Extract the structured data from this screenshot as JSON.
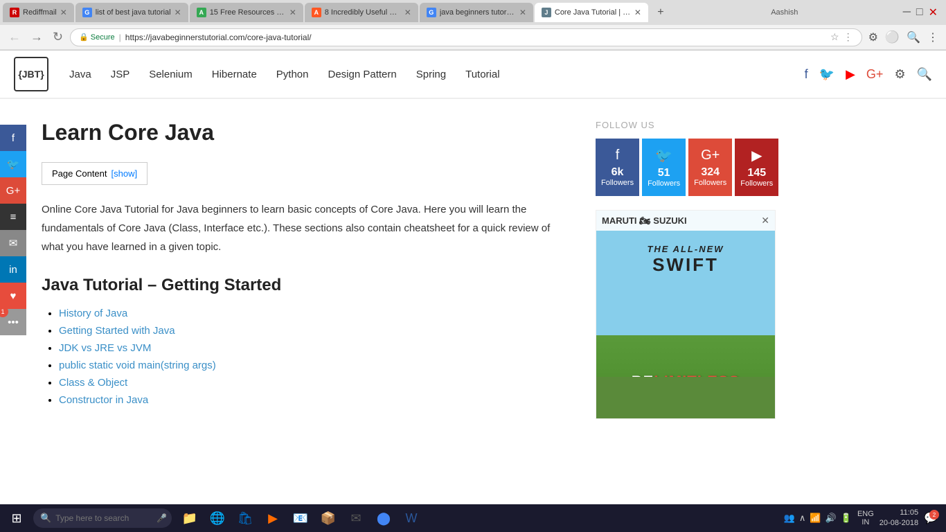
{
  "browser": {
    "tabs": [
      {
        "id": "tab1",
        "favicon_color": "#cc0000",
        "label": "Rediffmail",
        "active": false
      },
      {
        "id": "tab2",
        "favicon_color": "#4285f4",
        "label": "list of best java tutorial",
        "active": false
      },
      {
        "id": "tab3",
        "favicon_color": "#34a853",
        "label": "15 Free Resources to Le...",
        "active": false
      },
      {
        "id": "tab4",
        "favicon_color": "#ff5722",
        "label": "8 Incredibly Useful web...",
        "active": false
      },
      {
        "id": "tab5",
        "favicon_color": "#4285f4",
        "label": "java beginners tutorials",
        "active": false
      },
      {
        "id": "tab6",
        "favicon_color": "#607d8b",
        "label": "Core Java Tutorial | Lea...",
        "active": true
      }
    ],
    "user_name": "Aashish",
    "url_protocol": "Secure",
    "url_full": "https://javabeginnerstutorial.com/core-java-tutorial/"
  },
  "site": {
    "logo_text": "{JBT}",
    "nav": [
      {
        "label": "Java"
      },
      {
        "label": "JSP"
      },
      {
        "label": "Selenium"
      },
      {
        "label": "Hibernate"
      },
      {
        "label": "Python"
      },
      {
        "label": "Design Pattern"
      },
      {
        "label": "Spring"
      },
      {
        "label": "Tutorial"
      }
    ]
  },
  "social_sidebar": [
    {
      "platform": "facebook",
      "symbol": "f",
      "class": "fb"
    },
    {
      "platform": "twitter",
      "symbol": "🐦",
      "class": "tw"
    },
    {
      "platform": "google-plus",
      "symbol": "G+",
      "class": "gp"
    },
    {
      "platform": "layers",
      "symbol": "≡",
      "class": "layers"
    },
    {
      "platform": "email",
      "symbol": "✉",
      "class": "email"
    },
    {
      "platform": "linkedin",
      "symbol": "in",
      "class": "linkedin"
    },
    {
      "platform": "heart",
      "symbol": "♥",
      "class": "heart"
    },
    {
      "platform": "more",
      "symbol": "•••",
      "class": "more"
    }
  ],
  "page": {
    "title": "Learn Core Java",
    "toc_label": "Page Content",
    "toc_show": "[show]",
    "intro": "Online Core Java Tutorial for Java beginners to learn basic concepts of Core Java. Here you will learn the fundamentals of Core Java (Class, Interface etc.). These sections also contain cheatsheet for a quick review of what you have learned in a given topic.",
    "section_title": "Java Tutorial – Getting Started",
    "tutorial_links": [
      {
        "label": "History of Java",
        "href": "#"
      },
      {
        "label": "Getting Started with Java",
        "href": "#"
      },
      {
        "label": "JDK vs JRE vs JVM",
        "href": "#"
      },
      {
        "label": "public static void main(string args)",
        "href": "#"
      },
      {
        "label": "Class & Object",
        "href": "#"
      },
      {
        "label": "Constructor in Java",
        "href": "#"
      }
    ]
  },
  "follow_us": {
    "label": "FOLLOW US",
    "cards": [
      {
        "platform": "facebook",
        "symbol": "f",
        "count": "6k",
        "followers": "Followers",
        "class": "fb-card"
      },
      {
        "platform": "twitter",
        "symbol": "🐦",
        "count": "51",
        "followers": "Followers",
        "class": "tw-card"
      },
      {
        "platform": "google-plus",
        "symbol": "G+",
        "count": "324",
        "followers": "Followers",
        "class": "gp-card"
      },
      {
        "platform": "youtube",
        "symbol": "▶",
        "count": "145",
        "followers": "Followers",
        "class": "yt-card"
      }
    ]
  },
  "ad": {
    "brand": "MARUTI 🏍 SUZUKI",
    "tagline_swift": "THE ALL-NEW SWIFT",
    "tagline_be": "BE",
    "tagline_limitless": "LIMITLESS"
  },
  "taskbar": {
    "search_placeholder": "Type here to search",
    "time": "11:05",
    "date": "20-08-2018",
    "language": "ENG\nIN",
    "notification_count": "2"
  }
}
